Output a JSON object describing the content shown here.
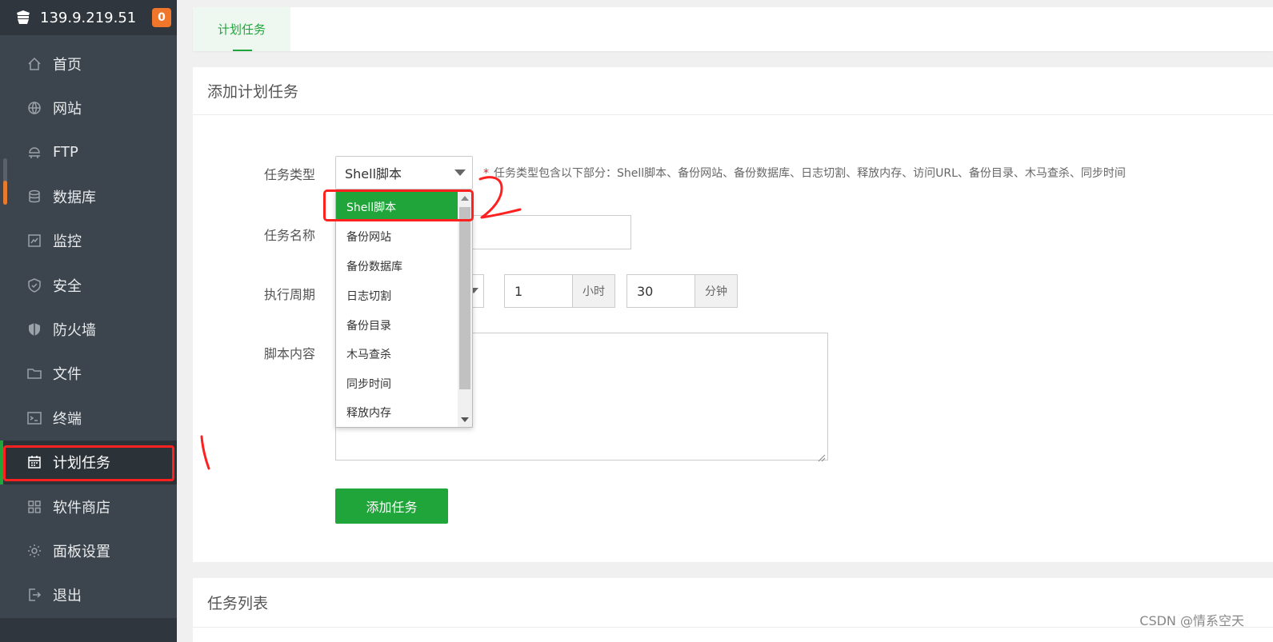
{
  "server": {
    "ip": "139.9.219.51",
    "badge": "0"
  },
  "sidebar": {
    "items": [
      {
        "label": "首页",
        "icon": "home-icon"
      },
      {
        "label": "网站",
        "icon": "globe-icon"
      },
      {
        "label": "FTP",
        "icon": "ftp-icon"
      },
      {
        "label": "数据库",
        "icon": "database-icon"
      },
      {
        "label": "监控",
        "icon": "monitor-icon"
      },
      {
        "label": "安全",
        "icon": "shield-check-icon"
      },
      {
        "label": "防火墙",
        "icon": "firewall-icon"
      },
      {
        "label": "文件",
        "icon": "folder-icon"
      },
      {
        "label": "终端",
        "icon": "terminal-icon"
      },
      {
        "label": "计划任务",
        "icon": "calendar-icon"
      },
      {
        "label": "软件商店",
        "icon": "apps-icon"
      },
      {
        "label": "面板设置",
        "icon": "gear-icon"
      },
      {
        "label": "退出",
        "icon": "logout-icon"
      }
    ],
    "active_index": 9
  },
  "tabs": {
    "active": "计划任务"
  },
  "form": {
    "title": "添加计划任务",
    "type_label": "任务类型",
    "type_value": "Shell脚本",
    "type_hint_star": "*",
    "type_hint": "任务类型包含以下部分：Shell脚本、备份网站、备份数据库、日志切割、释放内存、访问URL、备份目录、木马查杀、同步时间",
    "name_label": "任务名称",
    "cycle_label": "执行周期",
    "hour_value": "1",
    "hour_unit": "小时",
    "minute_value": "30",
    "minute_unit": "分钟",
    "script_label": "脚本内容",
    "submit": "添加任务"
  },
  "dropdown": {
    "options": [
      "Shell脚本",
      "备份网站",
      "备份数据库",
      "日志切割",
      "备份目录",
      "木马查杀",
      "同步时间",
      "释放内存"
    ],
    "selected_index": 0
  },
  "list": {
    "title": "任务列表"
  },
  "annotations": {
    "one": "1",
    "two": "2"
  },
  "watermark": "CSDN @情系空天",
  "colors": {
    "accent": "#20a53a",
    "sidebar": "#3c444d",
    "badge": "#f0762b",
    "annotation": "#ff2020"
  }
}
